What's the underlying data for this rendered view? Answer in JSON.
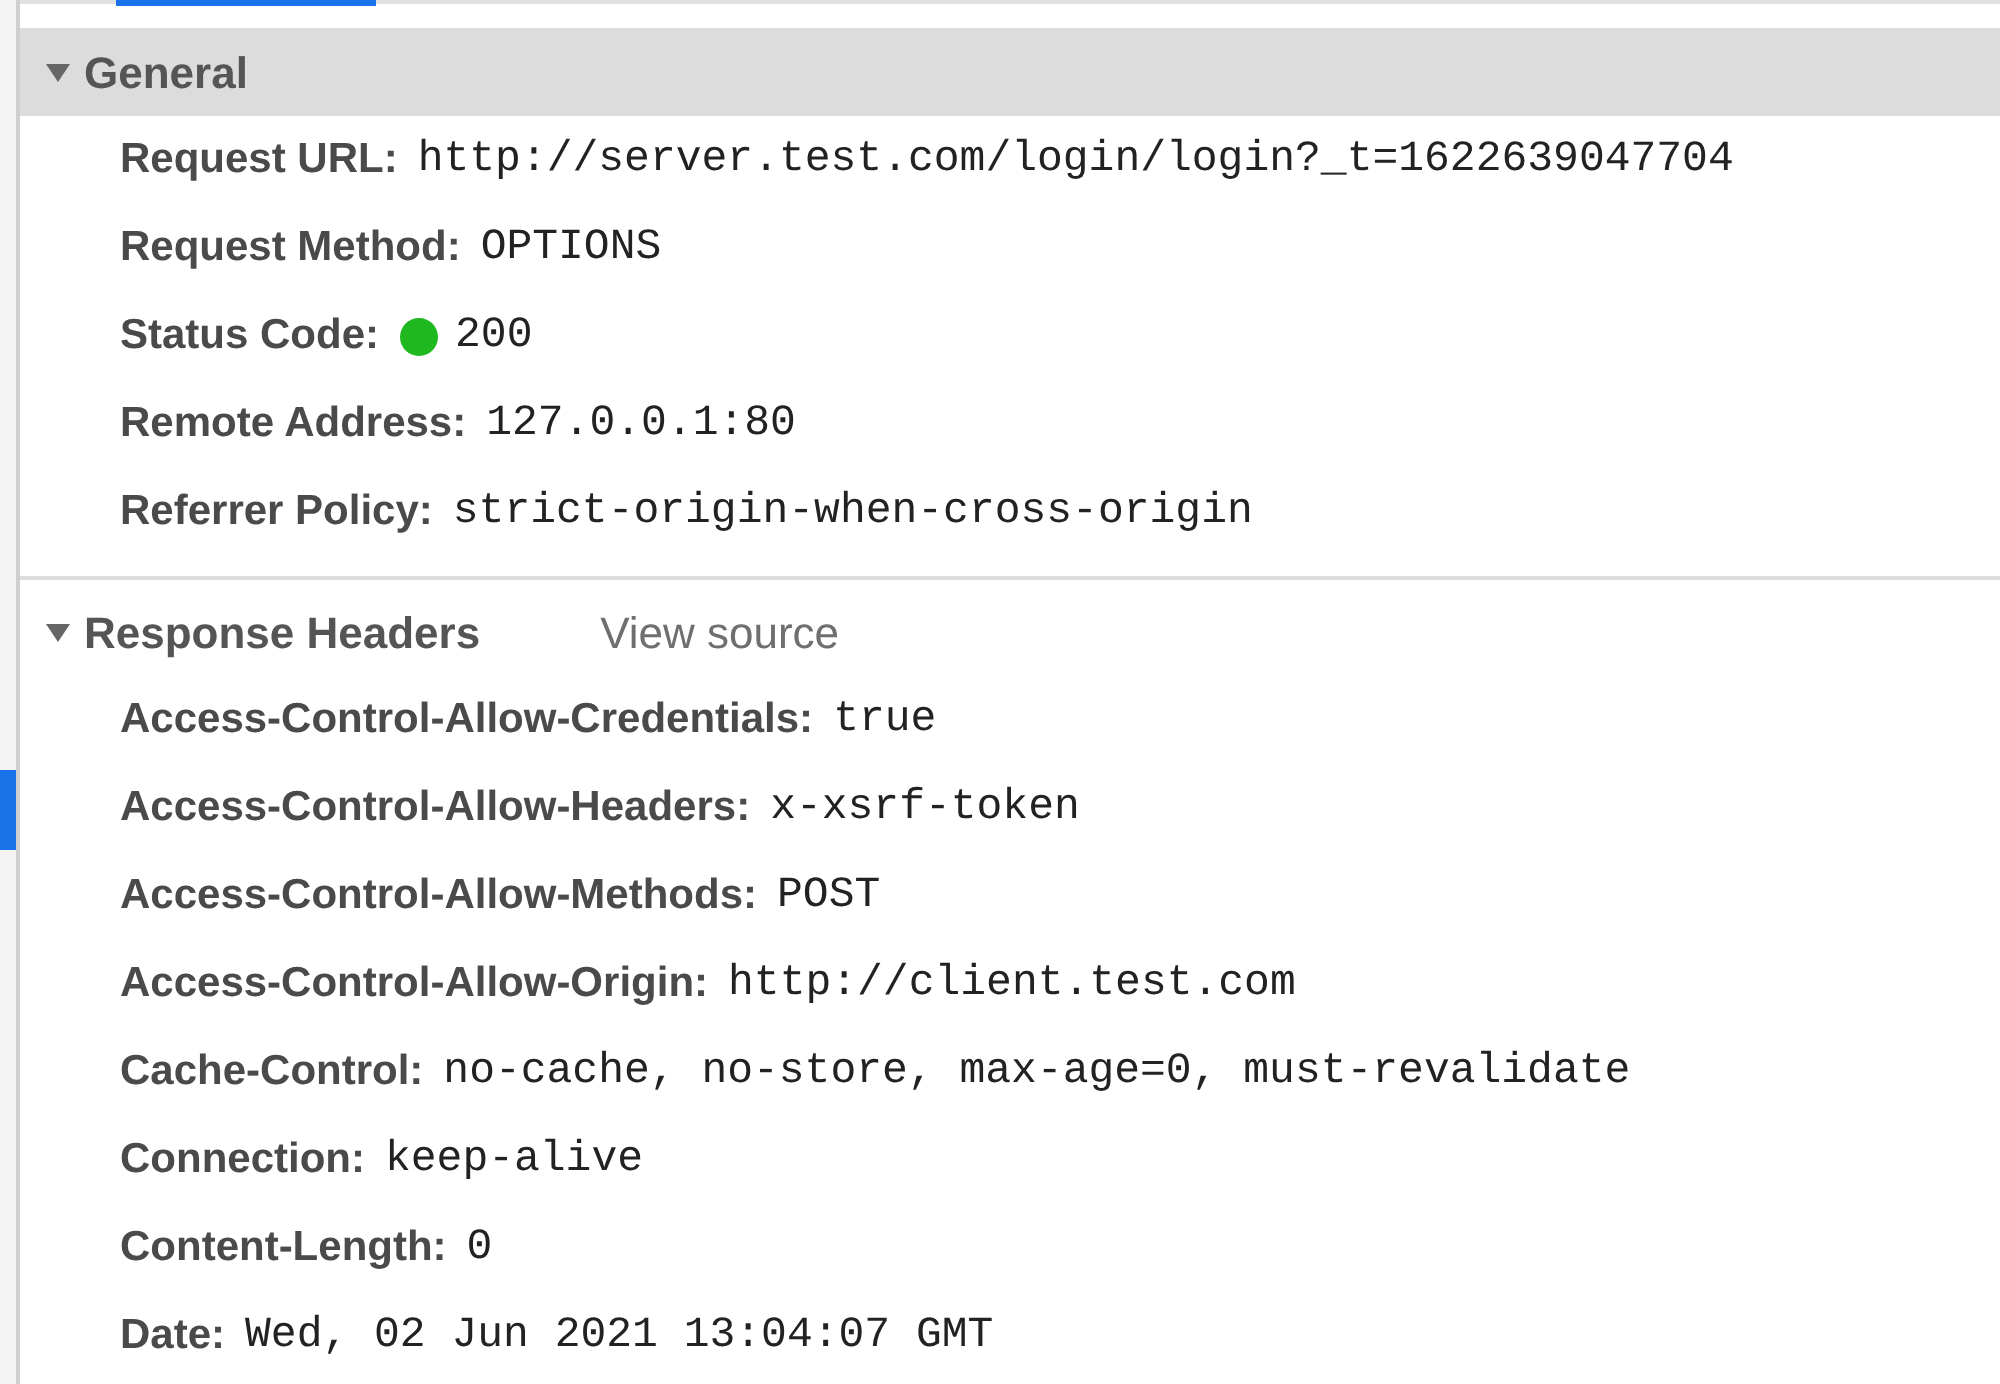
{
  "sections": [
    {
      "title": "General",
      "expanded": true,
      "rows": [
        {
          "kind": "text",
          "label": "Request URL:",
          "value": "http://server.test.com/login/login?_t=1622639047704"
        },
        {
          "kind": "text",
          "label": "Request Method:",
          "value": "OPTIONS"
        },
        {
          "kind": "status",
          "label": "Status Code:",
          "value": "200",
          "color": "#1fb81f"
        },
        {
          "kind": "text",
          "label": "Remote Address:",
          "value": "127.0.0.1:80"
        },
        {
          "kind": "text",
          "label": "Referrer Policy:",
          "value": "strict-origin-when-cross-origin"
        }
      ]
    },
    {
      "title": "Response Headers",
      "expanded": true,
      "link": "View source",
      "rows": [
        {
          "kind": "text",
          "label": "Access-Control-Allow-Credentials:",
          "value": "true"
        },
        {
          "kind": "text",
          "label": "Access-Control-Allow-Headers:",
          "value": "x-xsrf-token"
        },
        {
          "kind": "text",
          "label": "Access-Control-Allow-Methods:",
          "value": "POST"
        },
        {
          "kind": "text",
          "label": "Access-Control-Allow-Origin:",
          "value": "http://client.test.com"
        },
        {
          "kind": "text",
          "label": "Cache-Control:",
          "value": "no-cache, no-store, max-age=0, must-revalidate"
        },
        {
          "kind": "text",
          "label": "Connection:",
          "value": "keep-alive"
        },
        {
          "kind": "text",
          "label": "Content-Length:",
          "value": "0"
        },
        {
          "kind": "text",
          "label": "Date:",
          "value": "Wed, 02 Jun 2021 13:04:07 GMT"
        }
      ]
    }
  ]
}
